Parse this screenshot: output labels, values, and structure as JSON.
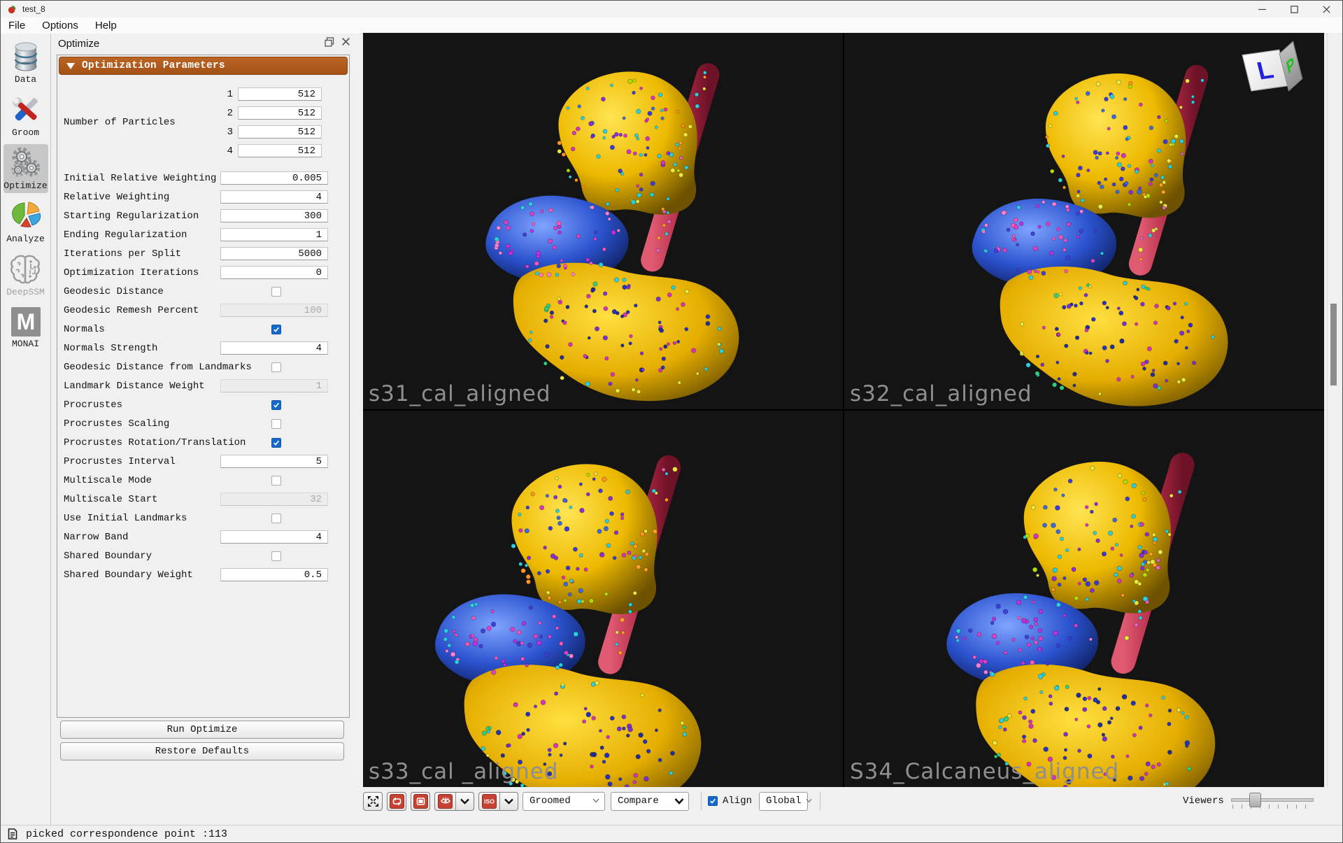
{
  "window": {
    "title": "test_8",
    "controls": [
      "minimize",
      "maximize",
      "close"
    ]
  },
  "menu": {
    "items": [
      "File",
      "Options",
      "Help"
    ]
  },
  "sidebar": {
    "items": [
      {
        "label": "Data",
        "icon": "database-icon",
        "selected": false,
        "disabled": false
      },
      {
        "label": "Groom",
        "icon": "tools-icon",
        "selected": false,
        "disabled": false
      },
      {
        "label": "Optimize",
        "icon": "gears-icon",
        "selected": true,
        "disabled": false
      },
      {
        "label": "Analyze",
        "icon": "pie-chart-icon",
        "selected": false,
        "disabled": false
      },
      {
        "label": "DeepSSM",
        "icon": "brain-icon",
        "selected": false,
        "disabled": true
      },
      {
        "label": "MONAI",
        "icon": "monai-icon",
        "selected": false,
        "disabled": false
      }
    ],
    "monai_letter": "M"
  },
  "panel": {
    "title": "Optimize",
    "header": "Optimization Parameters",
    "particles": {
      "label": "Number of Particles",
      "rows": [
        {
          "index": "1",
          "value": "512"
        },
        {
          "index": "2",
          "value": "512"
        },
        {
          "index": "3",
          "value": "512"
        },
        {
          "index": "4",
          "value": "512"
        }
      ]
    },
    "params": [
      {
        "label": "Initial Relative Weighting",
        "control": "input",
        "value": "0.005"
      },
      {
        "label": "Relative Weighting",
        "control": "input",
        "value": "4"
      },
      {
        "label": "Starting Regularization",
        "control": "input",
        "value": "300"
      },
      {
        "label": "Ending Regularization",
        "control": "input",
        "value": "1"
      },
      {
        "label": "Iterations per Split",
        "control": "input",
        "value": "5000"
      },
      {
        "label": "Optimization Iterations",
        "control": "input",
        "value": "0"
      },
      {
        "label": "Geodesic Distance",
        "control": "checkbox",
        "checked": false
      },
      {
        "label": "Geodesic Remesh Percent",
        "control": "input-disabled",
        "value": "100"
      },
      {
        "label": "Normals",
        "control": "checkbox",
        "checked": true
      },
      {
        "label": "Normals Strength",
        "control": "input",
        "value": "4"
      },
      {
        "label": "Geodesic Distance from Landmarks",
        "control": "checkbox",
        "checked": false
      },
      {
        "label": "Landmark Distance Weight",
        "control": "input-disabled",
        "value": "1"
      },
      {
        "label": "Procrustes",
        "control": "checkbox",
        "checked": true
      },
      {
        "label": "Procrustes Scaling",
        "control": "checkbox",
        "checked": false
      },
      {
        "label": "Procrustes Rotation/Translation",
        "control": "checkbox",
        "checked": true
      },
      {
        "label": "Procrustes Interval",
        "control": "input",
        "value": "5"
      },
      {
        "label": "Multiscale Mode",
        "control": "checkbox",
        "checked": false
      },
      {
        "label": "Multiscale Start",
        "control": "input-disabled",
        "value": "32"
      },
      {
        "label": "Use Initial Landmarks",
        "control": "checkbox",
        "checked": false
      },
      {
        "label": "Narrow Band",
        "control": "input",
        "value": "4"
      },
      {
        "label": "Shared Boundary",
        "control": "checkbox",
        "checked": false
      },
      {
        "label": "Shared Boundary Weight",
        "control": "input",
        "value": "0.5"
      }
    ],
    "run_button": "Run Optimize",
    "defaults_button": "Restore Defaults"
  },
  "viewer": {
    "viewports": [
      {
        "label": "s31_cal_aligned"
      },
      {
        "label": "s32_cal_aligned"
      },
      {
        "label": "s33_cal _aligned"
      },
      {
        "label": "S34_Calcaneus_aligned"
      }
    ],
    "orientation_cube": {
      "left_label": "L",
      "posterior_label": "P"
    },
    "toolbar": {
      "icons": [
        "autoview-icon",
        "center-icon",
        "image-export-icon",
        "visibility-icon",
        "isosurface-icon"
      ],
      "iso_label": "ISO",
      "groomed_select": "Groomed",
      "compare_select": "Compare",
      "align_label": "Align",
      "align_checked": true,
      "global_select": "Global",
      "viewers_label": "Viewers"
    }
  },
  "statusbar": {
    "message": "picked correspondence point :113"
  },
  "colors": {
    "header_orange": "#ad5a1b",
    "checkbox_blue": "#1668c9",
    "toolbar_red": "#c64333",
    "viewport_label_gray": "#8f8f8f"
  }
}
